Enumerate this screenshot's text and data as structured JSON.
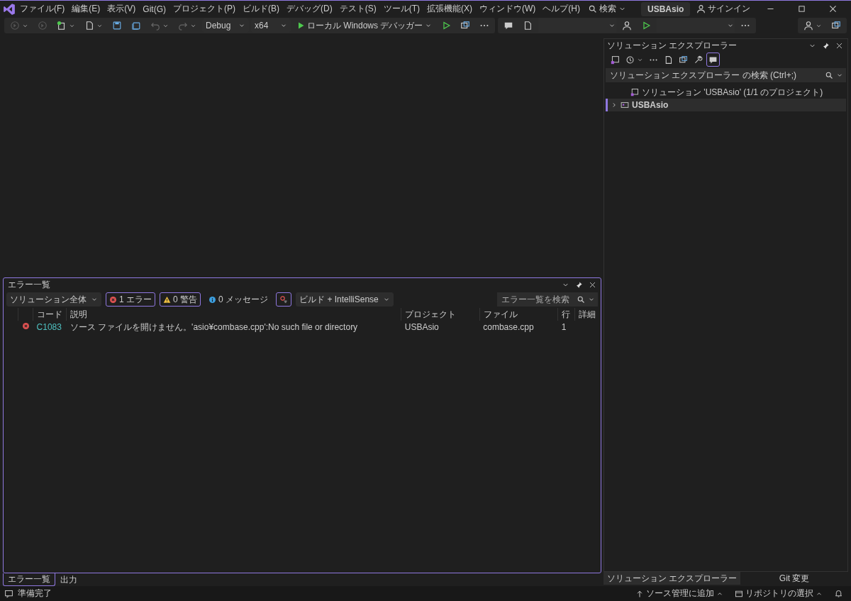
{
  "menu": [
    {
      "label": "ファイル(F)"
    },
    {
      "label": "編集(E)"
    },
    {
      "label": "表示(V)"
    },
    {
      "label": "Git(G)"
    },
    {
      "label": "プロジェクト(P)"
    },
    {
      "label": "ビルド(B)"
    },
    {
      "label": "デバッグ(D)"
    },
    {
      "label": "テスト(S)"
    },
    {
      "label": "ツール(T)"
    },
    {
      "label": "拡張機能(X)"
    },
    {
      "label": "ウィンドウ(W)"
    },
    {
      "label": "ヘルプ(H)"
    }
  ],
  "search": {
    "label": "検索"
  },
  "solution_name": "USBAsio",
  "signin": "サインイン",
  "toolbar": {
    "configuration": "Debug",
    "platform": "x64",
    "run_target": "ローカル Windows デバッガー"
  },
  "error_list": {
    "title": "エラー一覧",
    "scope": "ソリューション全体",
    "filters": [
      {
        "kind": "error",
        "label": "1 エラー",
        "selected": true
      },
      {
        "kind": "warning",
        "label": "0 警告",
        "selected": true
      },
      {
        "kind": "message",
        "label": "0 メッセージ",
        "selected": false
      }
    ],
    "source": "ビルド + IntelliSense",
    "search_placeholder": "エラー一覧を検索",
    "columns": [
      "コード",
      "説明",
      "プロジェクト",
      "ファイル",
      "行",
      "詳細"
    ],
    "rows": [
      {
        "kind": "error",
        "code": "C1083",
        "description": "ソース ファイルを開けません。'asio¥combase.cpp':No such file or directory",
        "project": "USBAsio",
        "file": "combase.cpp",
        "line": "1"
      }
    ]
  },
  "bottom_tabs": [
    {
      "label": "エラー一覧",
      "selected": true
    },
    {
      "label": "出力",
      "selected": false
    }
  ],
  "solution_explorer": {
    "title": "ソリューション エクスプローラー",
    "search_placeholder": "ソリューション エクスプローラー の検索 (Ctrl+;)",
    "tree": [
      {
        "kind": "solution",
        "label": "ソリューション 'USBAsio' (1/1 のプロジェクト)",
        "selected": false,
        "children": [
          {
            "kind": "project",
            "label": "USBAsio",
            "expanded": false,
            "selected": true
          }
        ]
      }
    ]
  },
  "side_tabs": [
    {
      "label": "ソリューション エクスプローラー",
      "selected": true
    },
    {
      "label": "Git 変更",
      "selected": false
    }
  ],
  "status_bar": {
    "status": "準備完了",
    "items": [
      "ソース管理に追加",
      "リポジトリの選択"
    ]
  }
}
